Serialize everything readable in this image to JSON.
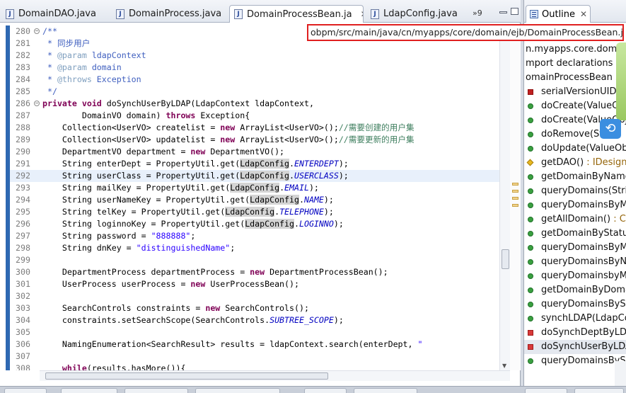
{
  "editor": {
    "tabs": [
      {
        "label": "DomainDAO.java",
        "active": false
      },
      {
        "label": "DomainProcess.java",
        "active": false
      },
      {
        "label": "DomainProcessBean.ja",
        "active": true
      },
      {
        "label": "LdapConfig.java",
        "active": false
      }
    ],
    "overflow": "»9",
    "path_tooltip": "obpm/src/main/java/cn/myapps/core/domain/ejb/DomainProcessBean.java",
    "lines": [
      {
        "n": "280",
        "fold": true,
        "html": "<span class=\"cm\">/**</span>"
      },
      {
        "n": "281",
        "html": "<span class=\"cm\"> * 同步用户</span>"
      },
      {
        "n": "282",
        "html": "<span class=\"cm\"> * <span class=\"tg\">@param</span> ldapContext</span>"
      },
      {
        "n": "283",
        "html": "<span class=\"cm\"> * <span class=\"tg\">@param</span> domain</span>"
      },
      {
        "n": "284",
        "html": "<span class=\"cm\"> * <span class=\"tg\">@throws</span> Exception</span>"
      },
      {
        "n": "285",
        "html": "<span class=\"cm\"> */</span>"
      },
      {
        "n": "286",
        "fold": true,
        "html": "<span class=\"kw\">private</span> <span class=\"kw\">void</span> doSynchUserByLDAP(LdapContext ldapContext,"
      },
      {
        "n": "287",
        "html": "        DomainVO domain) <span class=\"kw\">throws</span> Exception{"
      },
      {
        "n": "288",
        "html": "    Collection&lt;UserVO&gt; createlist = <span class=\"kw\">new</span> ArrayList&lt;UserVO&gt;();<span class=\"cc\">//需要创建的用户集</span>"
      },
      {
        "n": "289",
        "html": "    Collection&lt;UserVO&gt; updatelist = <span class=\"kw\">new</span> ArrayList&lt;UserVO&gt;();<span class=\"cc\">//需要更新的用户集</span>"
      },
      {
        "n": "290",
        "html": "    DepartmentVO department = <span class=\"kw\">new</span> DepartmentVO();"
      },
      {
        "n": "291",
        "html": "    String enterDept = PropertyUtil.get(<span class=\"hl\">LdapConfig</span>.<span class=\"cn\">ENTERDEPT</span>);"
      },
      {
        "n": "292",
        "cur": true,
        "html": "    String userClass = PropertyUtil.get(<span class=\"hl\">LdapConfig</span>.<span class=\"cn\">USERCLASS</span>);"
      },
      {
        "n": "293",
        "html": "    String mailKey = PropertyUtil.get(<span class=\"hl\">LdapConfig</span>.<span class=\"cn\">EMAIL</span>);"
      },
      {
        "n": "294",
        "html": "    String userNameKey = PropertyUtil.get(<span class=\"hl\">LdapConfig</span>.<span class=\"cn\">NAME</span>);"
      },
      {
        "n": "295",
        "html": "    String telKey = PropertyUtil.get(<span class=\"hl\">LdapConfig</span>.<span class=\"cn\">TELEPHONE</span>);"
      },
      {
        "n": "296",
        "html": "    String loginnoKey = PropertyUtil.get(<span class=\"hl\">LdapConfig</span>.<span class=\"cn\">LOGINNO</span>);"
      },
      {
        "n": "297",
        "html": "    String password = <span class=\"st\">\"888888\"</span>;"
      },
      {
        "n": "298",
        "html": "    String dnKey = <span class=\"st\">\"distinguishedName\"</span>;"
      },
      {
        "n": "299",
        "html": ""
      },
      {
        "n": "300",
        "html": "    DepartmentProcess departmentProcess = <span class=\"kw\">new</span> DepartmentProcessBean();"
      },
      {
        "n": "301",
        "html": "    UserProcess userProcess = <span class=\"kw\">new</span> UserProcessBean();"
      },
      {
        "n": "302",
        "html": ""
      },
      {
        "n": "303",
        "html": "    SearchControls constraints = <span class=\"kw\">new</span> SearchControls();"
      },
      {
        "n": "304",
        "html": "    constraints.setSearchScope(SearchControls.<span class=\"cn\">SUBTREE_SCOPE</span>);"
      },
      {
        "n": "305",
        "html": ""
      },
      {
        "n": "306",
        "html": "    NamingEnumeration&lt;SearchResult&gt; results = ldapContext.search(enterDept, <span class=\"st\">\"</span>"
      },
      {
        "n": "307",
        "html": ""
      },
      {
        "n": "308",
        "html": "    <span class=\"kw\">while</span>(results.hasMore()){"
      }
    ]
  },
  "outline": {
    "tab_label": "Outline",
    "items": [
      {
        "icon": "none",
        "text": "n.myapps.core.domai",
        "indent": -22
      },
      {
        "icon": "none",
        "text": "mport declarations",
        "indent": -22
      },
      {
        "icon": "none",
        "text": "omainProcessBean",
        "type": " 2",
        "indent": -22
      },
      {
        "icon": "stat",
        "text": "serialVersionUID",
        "type": " : "
      },
      {
        "icon": "pub",
        "text": "doCreate(ValueObje"
      },
      {
        "icon": "pub",
        "text": "doCreate(ValueObjec"
      },
      {
        "icon": "pub",
        "text": "doRemove(Stri"
      },
      {
        "icon": "pub",
        "text": "doUpdate(ValueObje"
      },
      {
        "icon": "prot",
        "text": "getDAO()",
        "type": " : IDesignTi"
      },
      {
        "icon": "pub",
        "text": "getDomainByName(S"
      },
      {
        "icon": "pub",
        "text": "queryDomains(String"
      },
      {
        "icon": "pub",
        "text": "queryDomainsByMan"
      },
      {
        "icon": "pub",
        "text": "getAllDomain()",
        "type": " : Colle"
      },
      {
        "icon": "pub",
        "text": "getDomainByStatus(i"
      },
      {
        "icon": "pub",
        "text": "queryDomainsByMan"
      },
      {
        "icon": "pub",
        "text": "queryDomainsByNan"
      },
      {
        "icon": "pub",
        "text": "queryDomainsbyMan"
      },
      {
        "icon": "pub",
        "text": "getDomainByDomain"
      },
      {
        "icon": "pub",
        "text": "queryDomainsByStat"
      },
      {
        "icon": "pub",
        "text": "synchLDAP(LdapCont"
      },
      {
        "icon": "priv",
        "text": "doSynchDeptByLDAP"
      },
      {
        "icon": "priv",
        "text": "doSynchUserByLDAP",
        "sel": true
      },
      {
        "icon": "pub",
        "text": "queryDomainsByStat"
      }
    ]
  }
}
